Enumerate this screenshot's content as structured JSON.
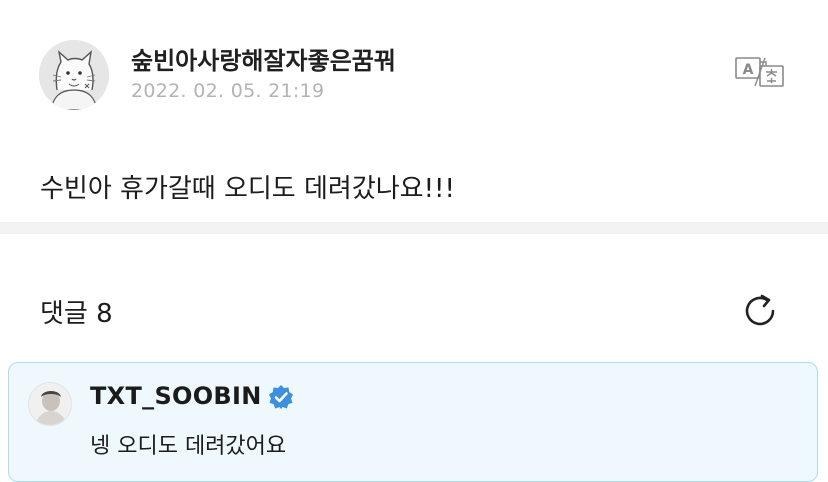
{
  "post": {
    "author": "숲빈아사랑해잘자좋은꿈꿔",
    "date": "2022. 02. 05. 21:19",
    "body": "수빈아 휴가갈때 오디도 데려갔나요!!!",
    "avatar_icon": "cat-doodle-avatar",
    "translate_icon": "translate-icon"
  },
  "comments": {
    "header_label": "댓글 8",
    "refresh_icon": "refresh-icon",
    "items": [
      {
        "author": "TXT_SOOBIN",
        "verified": true,
        "text": "넹 오디도 데려갔어요",
        "highlight": true
      }
    ]
  },
  "colors": {
    "accent_blue": "#3d8fe0",
    "comment_bg": "#eef8fd",
    "comment_border": "#a9def4",
    "date_gray": "#b3b3b3"
  }
}
